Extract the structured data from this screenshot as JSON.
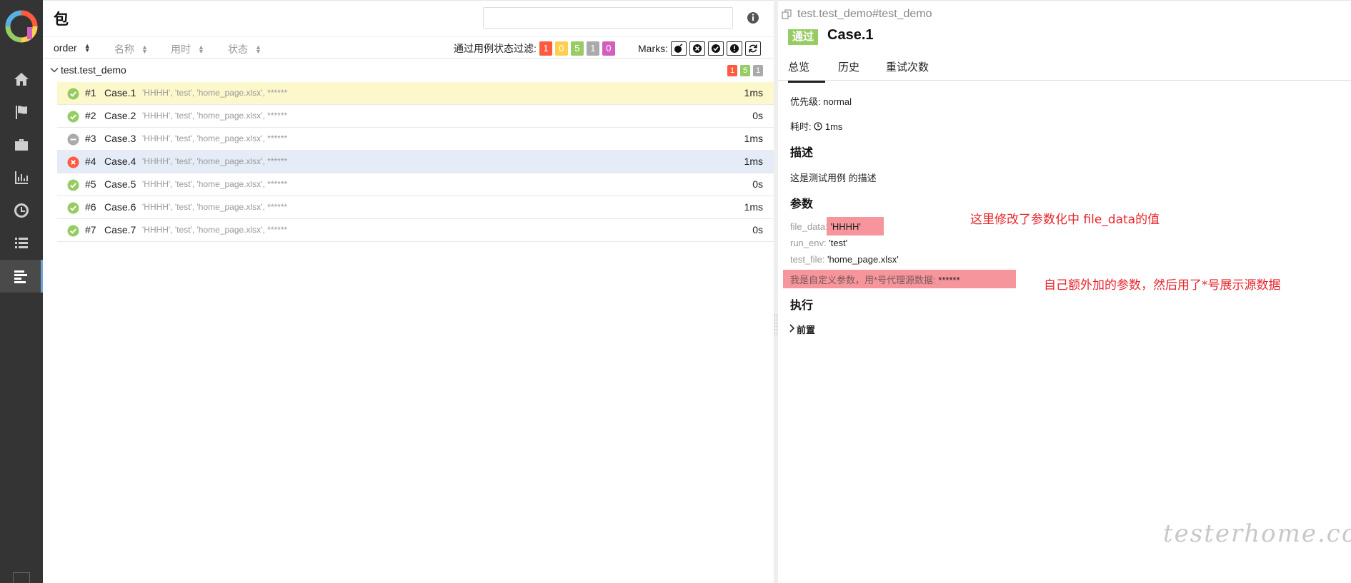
{
  "left": {
    "title": "包",
    "search": {
      "value": "",
      "placeholder": ""
    },
    "sort": [
      {
        "label": "order",
        "active": true
      },
      {
        "label": "名称",
        "active": false
      },
      {
        "label": "用时",
        "active": false
      },
      {
        "label": "状态",
        "active": false
      }
    ],
    "filter": {
      "label": "通过用例状态过滤:",
      "badges": [
        {
          "value": "1",
          "color": "#fd5a3e"
        },
        {
          "value": "0",
          "color": "#ffd050"
        },
        {
          "value": "5",
          "color": "#97cc64"
        },
        {
          "value": "1",
          "color": "#aaaaaa"
        },
        {
          "value": "0",
          "color": "#d35ebe"
        }
      ]
    },
    "marks": {
      "label": "Marks:",
      "icons": [
        "flaky-icon",
        "new-failed-icon",
        "new-passed-icon",
        "new-broken-icon",
        "retry-icon"
      ]
    },
    "group": {
      "name": "test.test_demo",
      "counts": [
        {
          "value": "1",
          "color": "#fd5a3e"
        },
        {
          "value": "5",
          "color": "#97cc64"
        },
        {
          "value": "1",
          "color": "#aaaaaa"
        }
      ]
    },
    "cases": [
      {
        "num": "#1",
        "name": "Case.1",
        "params": "'HHHH', 'test', 'home_page.xlsx', ******",
        "duration": "1ms",
        "status": "passed"
      },
      {
        "num": "#2",
        "name": "Case.2",
        "params": "'HHHH', 'test', 'home_page.xlsx', ******",
        "duration": "0s",
        "status": "passed"
      },
      {
        "num": "#3",
        "name": "Case.3",
        "params": "'HHHH', 'test', 'home_page.xlsx', ******",
        "duration": "1ms",
        "status": "skipped"
      },
      {
        "num": "#4",
        "name": "Case.4",
        "params": "'HHHH', 'test', 'home_page.xlsx', ******",
        "duration": "1ms",
        "status": "failed"
      },
      {
        "num": "#5",
        "name": "Case.5",
        "params": "'HHHH', 'test', 'home_page.xlsx', ******",
        "duration": "0s",
        "status": "passed"
      },
      {
        "num": "#6",
        "name": "Case.6",
        "params": "'HHHH', 'test', 'home_page.xlsx', ******",
        "duration": "1ms",
        "status": "passed"
      },
      {
        "num": "#7",
        "name": "Case.7",
        "params": "'HHHH', 'test', 'home_page.xlsx', ******",
        "duration": "0s",
        "status": "passed"
      }
    ]
  },
  "right": {
    "path": "test.test_demo#test_demo",
    "status_tag": "通过",
    "status_color": "#97cc64",
    "title": "Case.1",
    "tabs": [
      "总览",
      "历史",
      "重试次数"
    ],
    "priority": {
      "label": "优先级:",
      "value": "normal"
    },
    "duration": {
      "label": "耗时:",
      "value": "1ms"
    },
    "description": {
      "heading": "描述",
      "text": "这是测试用例 的描述"
    },
    "params": {
      "heading": "参数",
      "items": [
        {
          "name": "file_data",
          "value": "'HHHH'"
        },
        {
          "name": "run_env",
          "value": "'test'"
        },
        {
          "name": "test_file",
          "value": "'home_page.xlsx'"
        },
        {
          "name": "我是自定义参数，用*号代理源数据",
          "value": "******"
        }
      ]
    },
    "execution": {
      "heading": "执行",
      "setup": "前置"
    },
    "annotations": {
      "first": "这里修改了参数化中 file_data的值",
      "second": "自己额外加的参数，然后用了*号展示源数据"
    },
    "watermark": "testerhome.com"
  },
  "colors": {
    "passed": "#97cc64",
    "failed": "#fd5a3e",
    "skipped": "#aaaaaa",
    "highlight": "#f4838a"
  }
}
